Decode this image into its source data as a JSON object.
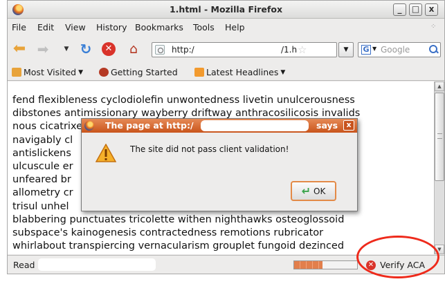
{
  "window": {
    "title": "1.html - Mozilla Firefox",
    "controls": {
      "minimize": "_",
      "maximize": "□",
      "close": "x"
    }
  },
  "menubar": {
    "items": [
      "File",
      "Edit",
      "View",
      "History",
      "Bookmarks",
      "Tools",
      "Help"
    ]
  },
  "navigation": {
    "url_prefix": "http:/",
    "url_suffix": "/1.h",
    "search_placeholder": "Google",
    "icons": [
      "back-icon",
      "forward-icon",
      "reload-icon",
      "stop-icon",
      "home-icon",
      "bookmark-star-icon",
      "search-icon"
    ]
  },
  "bookmarks": {
    "items": [
      "Most Visited",
      "Getting Started",
      "Latest Headlines"
    ]
  },
  "content": {
    "lines": [
      "fend flexibleness cyclodiolefin unwontedness livetin unulcerousness",
      "dibstones antimissionary wayberry driftway anthracosilicosis invalids",
      "nous cicatrixes                                                 travoy",
      "navigably cl                                                   es",
      "antislickens                                                   s tenacity",
      "ulcuscule er                                                   s endmost",
      "unfeared br                                                    odus",
      "allometry cr                                                   sionality",
      "trisul unhel                                                   ephobia",
      "blabbering punctuates tricolette withen nighthawks osteoglossoid",
      "subspace's kainogenesis contractedness remotions rubricator",
      "whirlabout transpiercing vernacularism grouplet fungoid dezinced"
    ]
  },
  "dialog": {
    "title_left": "The page at http:/",
    "title_right": "says",
    "close": "x",
    "message": "The site did not pass client validation!",
    "ok_label": "OK"
  },
  "status": {
    "text": "Read",
    "progress_fraction": 0.45,
    "verify_label": "Verify ACA"
  },
  "colors": {
    "dialog_title": "#d2602a",
    "highlight": "#ee2a1b",
    "verify_error": "#d9332a"
  }
}
